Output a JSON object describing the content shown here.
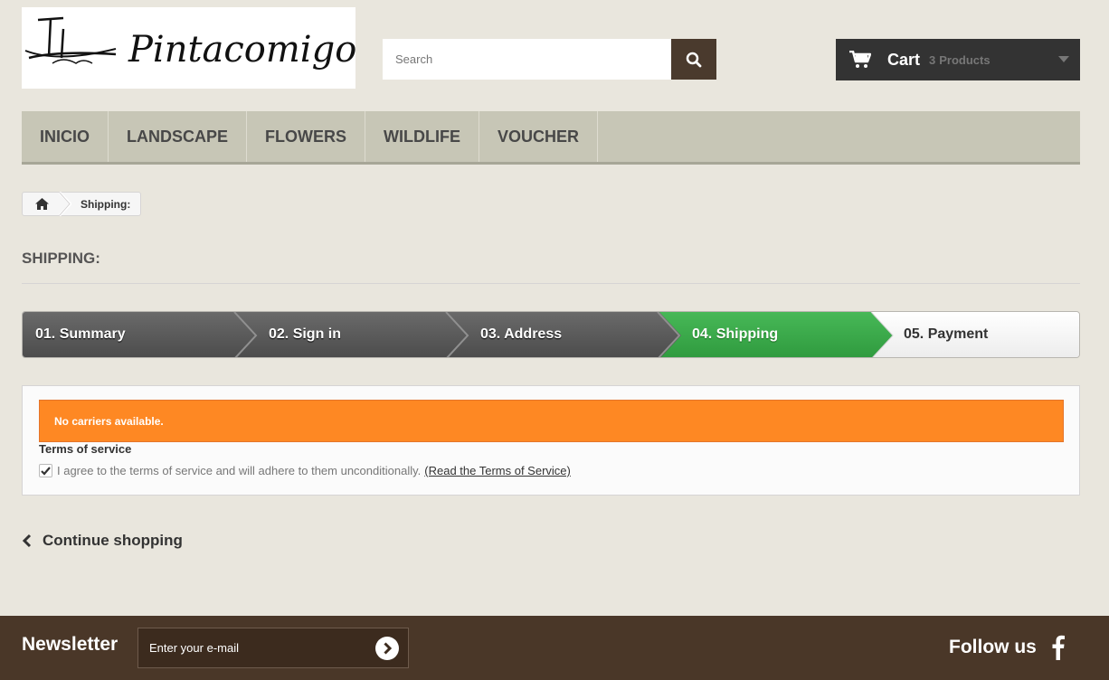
{
  "header": {
    "logo_text": "Pintacomigo",
    "search_placeholder": "Search",
    "cart": {
      "label": "Cart",
      "count": "3",
      "unit": "Products"
    }
  },
  "nav": [
    "INICIO",
    "LANDSCAPE",
    "FLOWERS",
    "WILDLIFE",
    "VOUCHER"
  ],
  "breadcrumb": {
    "current": "Shipping:"
  },
  "page_title": "SHIPPING:",
  "steps": [
    {
      "label": "01. Summary",
      "state": "done"
    },
    {
      "label": "02. Sign in",
      "state": "done"
    },
    {
      "label": "03. Address",
      "state": "done"
    },
    {
      "label": "04. Shipping",
      "state": "current"
    },
    {
      "label": "05. Payment",
      "state": "todo"
    }
  ],
  "alert": {
    "message": "No carriers available.",
    "color": "#fe8823"
  },
  "terms": {
    "title": "Terms of service",
    "checked": true,
    "text": "I agree to the terms of service and will adhere to them unconditionally.",
    "link": "(Read the Terms of Service)"
  },
  "continue_label": "Continue shopping",
  "footer": {
    "newsletter_title": "Newsletter",
    "newsletter_placeholder": "Enter your e-mail",
    "follow_label": "Follow us"
  },
  "colors": {
    "brand_brown": "#4a3728",
    "step_done": "#5a5a5a",
    "step_current": "#3aa44a",
    "nav_bg": "#c7c6b6"
  },
  "icons": [
    "home-icon",
    "search-icon",
    "cart-icon",
    "caret-down-icon",
    "chevron-left-icon",
    "arrow-right-icon",
    "facebook-icon",
    "check-icon"
  ]
}
